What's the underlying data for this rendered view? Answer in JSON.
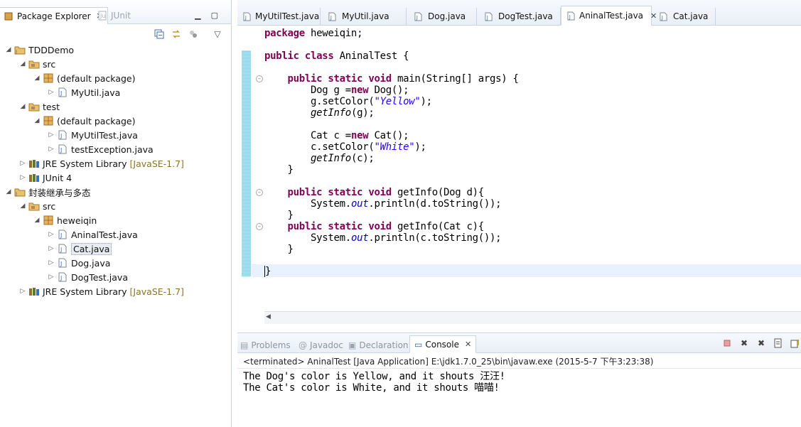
{
  "package_explorer": {
    "tab_label": "Package Explorer",
    "junit_tab_label": "JUnit",
    "tree": [
      {
        "label": "TDDDemo",
        "kind": "project",
        "indent": 0,
        "expanded": true,
        "deco": ""
      },
      {
        "label": "src",
        "kind": "source-folder",
        "indent": 1,
        "expanded": true,
        "deco": ""
      },
      {
        "label": "(default package)",
        "kind": "package",
        "indent": 2,
        "expanded": true,
        "deco": ""
      },
      {
        "label": "MyUtil.java",
        "kind": "java-file",
        "indent": 3,
        "expanded": false,
        "deco": ""
      },
      {
        "label": "test",
        "kind": "source-folder",
        "indent": 1,
        "expanded": true,
        "deco": ""
      },
      {
        "label": "(default package)",
        "kind": "package",
        "indent": 2,
        "expanded": true,
        "deco": ""
      },
      {
        "label": "MyUtilTest.java",
        "kind": "java-file",
        "indent": 3,
        "expanded": false,
        "deco": ""
      },
      {
        "label": "testException.java",
        "kind": "java-file",
        "indent": 3,
        "expanded": false,
        "deco": ""
      },
      {
        "label": "JRE System Library",
        "kind": "library",
        "indent": 1,
        "expanded": false,
        "deco": "[JavaSE-1.7]"
      },
      {
        "label": "JUnit 4",
        "kind": "library",
        "indent": 1,
        "expanded": false,
        "deco": ""
      },
      {
        "label": "封装继承与多态",
        "kind": "project",
        "indent": 0,
        "expanded": true,
        "deco": ""
      },
      {
        "label": "src",
        "kind": "source-folder",
        "indent": 1,
        "expanded": true,
        "deco": ""
      },
      {
        "label": "heweiqin",
        "kind": "package",
        "indent": 2,
        "expanded": true,
        "deco": ""
      },
      {
        "label": "AninalTest.java",
        "kind": "java-file",
        "indent": 3,
        "expanded": false,
        "deco": ""
      },
      {
        "label": "Cat.java",
        "kind": "java-file",
        "indent": 3,
        "expanded": false,
        "deco": "",
        "selected": true
      },
      {
        "label": "Dog.java",
        "kind": "java-file",
        "indent": 3,
        "expanded": false,
        "deco": ""
      },
      {
        "label": "DogTest.java",
        "kind": "java-file",
        "indent": 3,
        "expanded": false,
        "deco": ""
      },
      {
        "label": "JRE System Library",
        "kind": "library",
        "indent": 1,
        "expanded": false,
        "deco": "[JavaSE-1.7]"
      }
    ]
  },
  "editor": {
    "tabs": [
      {
        "label": "MyUtilTest.java",
        "active": false
      },
      {
        "label": "MyUtil.java",
        "active": false
      },
      {
        "label": "Dog.java",
        "active": false
      },
      {
        "label": "DogTest.java",
        "active": false
      },
      {
        "label": "AninalTest.java",
        "active": true
      },
      {
        "label": "Cat.java",
        "active": false
      }
    ],
    "code": {
      "pkg_kw": "package",
      "pkg_name": " heweiqin;",
      "cls_kw": "public class",
      "cls_name": " AninalTest {",
      "main_kw": "public static void",
      "main_sig": " main(String[] args) {",
      "l_dog_new_a": "Dog g =",
      "l_dog_new_kw": "new",
      "l_dog_new_b": " Dog();",
      "l_dog_color_a": "g.setColor(",
      "l_dog_color_str": "\"Yellow\"",
      "l_dog_color_b": ");",
      "l_dog_info_fn": "getInfo",
      "l_dog_info_b": "(g);",
      "l_cat_new_a": "Cat c =",
      "l_cat_new_kw": "new",
      "l_cat_new_b": " Cat();",
      "l_cat_color_a": "c.setColor(",
      "l_cat_color_str": "\"White\"",
      "l_cat_color_b": ");",
      "l_cat_info_fn": "getInfo",
      "l_cat_info_b": "(c);",
      "close_brace": "}",
      "m1_kw": "public static void",
      "m1_sig": " getInfo(Dog d){",
      "m1_a": "System.",
      "m1_out": "out",
      "m1_b": ".println(d.toString());",
      "m2_kw": "public static void",
      "m2_sig": " getInfo(Cat c){",
      "m2_a": "System.",
      "m2_out": "out",
      "m2_b": ".println(c.toString());",
      "end_brace": "}"
    }
  },
  "bottom_panel": {
    "tabs": [
      {
        "label": "Problems",
        "active": false
      },
      {
        "label": "Javadoc",
        "active": false
      },
      {
        "label": "Declaration",
        "active": false
      },
      {
        "label": "Console",
        "active": true
      }
    ],
    "console": {
      "description": "<terminated> AninalTest [Java Application] E:\\jdk1.7.0_25\\bin\\javaw.exe (2015-5-7 下午3:23:38)",
      "output": [
        "The Dog's color is Yellow, and it shouts 汪汪!",
        "The Cat's color is White, and it shouts 喵喵!"
      ]
    }
  },
  "colors": {
    "keyword": "#7f0055",
    "string": "#2a00ff",
    "field": "#0000c0",
    "library_decoration": "#8b7328"
  }
}
